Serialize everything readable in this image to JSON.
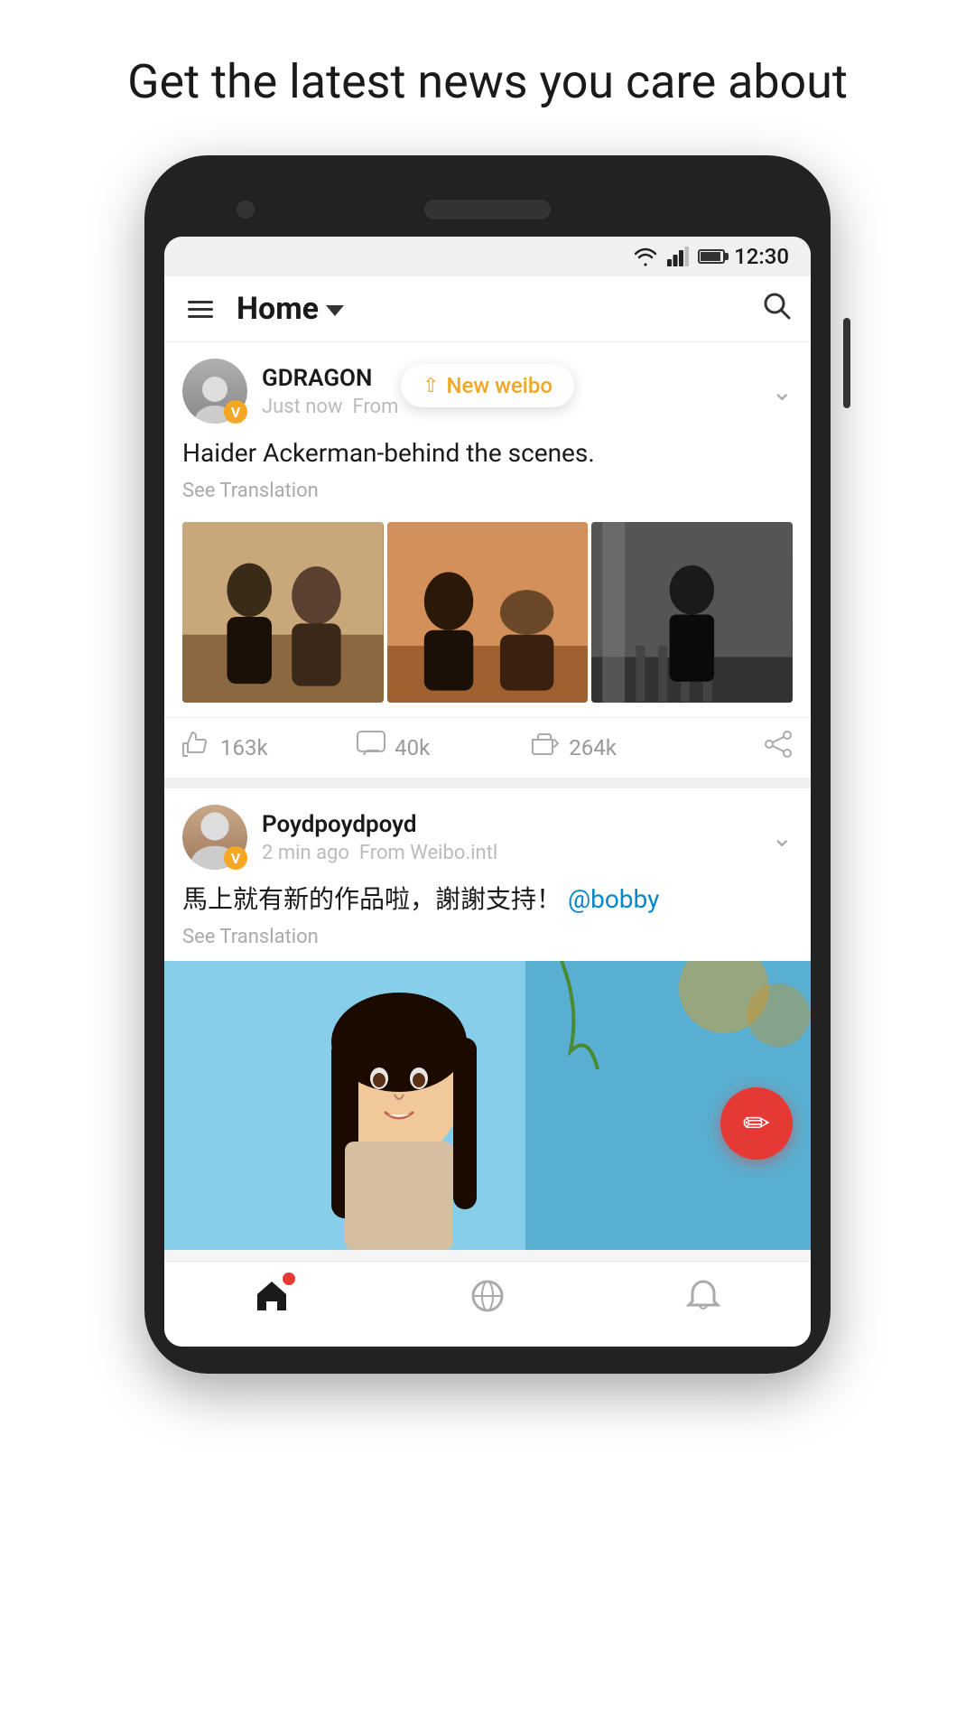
{
  "page": {
    "headline": "Get the latest news you care about"
  },
  "statusBar": {
    "time": "12:30"
  },
  "appHeader": {
    "title": "Home",
    "dropdownLabel": "Home dropdown"
  },
  "posts": [
    {
      "id": "post1",
      "username": "GDRAGON",
      "timeText": "Just now",
      "sourceText": "From",
      "verified": true,
      "verifiedLabel": "V",
      "newPillText": "New weibo",
      "postText": "Haider Ackerman-behind the scenes.",
      "seeTranslation": "See Translation",
      "images": [
        "img1",
        "img2",
        "img3"
      ],
      "likes": "163k",
      "comments": "40k",
      "reposts": "264k",
      "likeLabel": "163k",
      "commentLabel": "40k",
      "repostLabel": "264k"
    },
    {
      "id": "post2",
      "username": "Poydpoydpoyd",
      "timeText": "2 min ago",
      "sourceText": "From Weibo.intl",
      "verified": true,
      "verifiedLabel": "V",
      "postTextChinese": "馬上就有新的作品啦，謝謝支持！",
      "mention": "@bobby",
      "seeTranslation": "See Translation"
    }
  ],
  "fab": {
    "icon": "✏️"
  },
  "bottomNav": {
    "homeLabel": "Home",
    "discoverLabel": "Discover",
    "notifyLabel": "Notifications"
  }
}
